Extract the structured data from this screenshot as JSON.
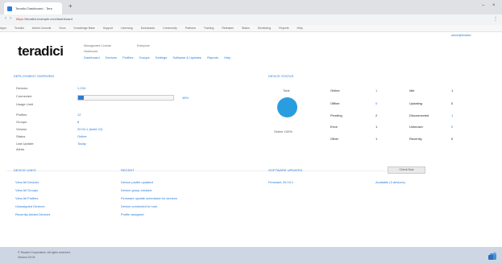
{
  "browser": {
    "tab_title": "Teradici Dashboard - Tera",
    "new_tab": "+",
    "window_controls": [
      "–",
      "×"
    ],
    "url_secure": "https://",
    "url_rest": "teradici.example.com/dashboard",
    "bookmarks": [
      "Apps",
      "Teradici",
      "Admin Console",
      "Docs",
      "Knowledge Base",
      "Support",
      "Licensing",
      "Downloads",
      "Community",
      "Partners",
      "Training",
      "Releases",
      "Status",
      "Monitoring",
      "Reports",
      "Help"
    ]
  },
  "header": {
    "user_link": "admin@teradici",
    "logo": "teradici",
    "product": "Management Console",
    "edition": "Enterprise",
    "subline": "Dashboard",
    "nav": [
      "Dashboard",
      "Devices",
      "Profiles",
      "Groups",
      "Settings",
      "Software & Updates",
      "Reports",
      "Help"
    ]
  },
  "left": {
    "section_title": "DEPLOYMENT OVERVIEW",
    "rows": [
      {
        "label": "Devices",
        "value": "1,234"
      },
      {
        "label": "Connected",
        "value": ""
      },
      {
        "label": "Usage Limit",
        "value": ""
      },
      {
        "label": "Profiles",
        "value": "12"
      },
      {
        "label": "Groups",
        "value": "8"
      },
      {
        "label": "Version",
        "value": "20.04.1 (build 22)"
      },
      {
        "label": "Status",
        "value": "Online"
      },
      {
        "label": "Last Update",
        "value": "Today"
      },
      {
        "label": "Alerts",
        "value": ""
      }
    ],
    "progress_value": "45%",
    "progress_fraction": 0.06
  },
  "right": {
    "section_title": "DEVICE STATUS",
    "total_label": "Total",
    "chart_label": "Online 100%",
    "stats": [
      {
        "label": "Online",
        "value": "1",
        "label2": "Idle",
        "value2": "1"
      },
      {
        "label": "Offline",
        "value": "0",
        "label2": "Updating",
        "value2": "0"
      },
      {
        "label": "Pending",
        "value": "2",
        "label2": "Disconnected",
        "value2": "1"
      },
      {
        "label": "Error",
        "value": "1",
        "label2": "Unknown",
        "value2": "0"
      },
      {
        "label": "Other",
        "value": "1",
        "label2": "Recently",
        "value2": "0"
      }
    ]
  },
  "bottom": {
    "device_links_title": "DEVICE LINKS",
    "device_links": [
      "View All Devices",
      "View All Groups",
      "View All Profiles",
      "Unassigned Devices",
      "Recently Added Devices"
    ],
    "recent_title": "RECENT",
    "recent_items": [
      "Device profile updated",
      "Device group created",
      "Firmware update scheduled for devices",
      "Device connected to host",
      "Profile assigned"
    ],
    "updates_title": "SOFTWARE UPDATES",
    "update_button": "Check Now",
    "update_row_label": "Firmware 20.04.1",
    "update_row_value": "Available (3 devices)"
  },
  "footer": {
    "line1": "© Teradici Corporation. All rights reserved.",
    "line2": "Version 20.04"
  }
}
